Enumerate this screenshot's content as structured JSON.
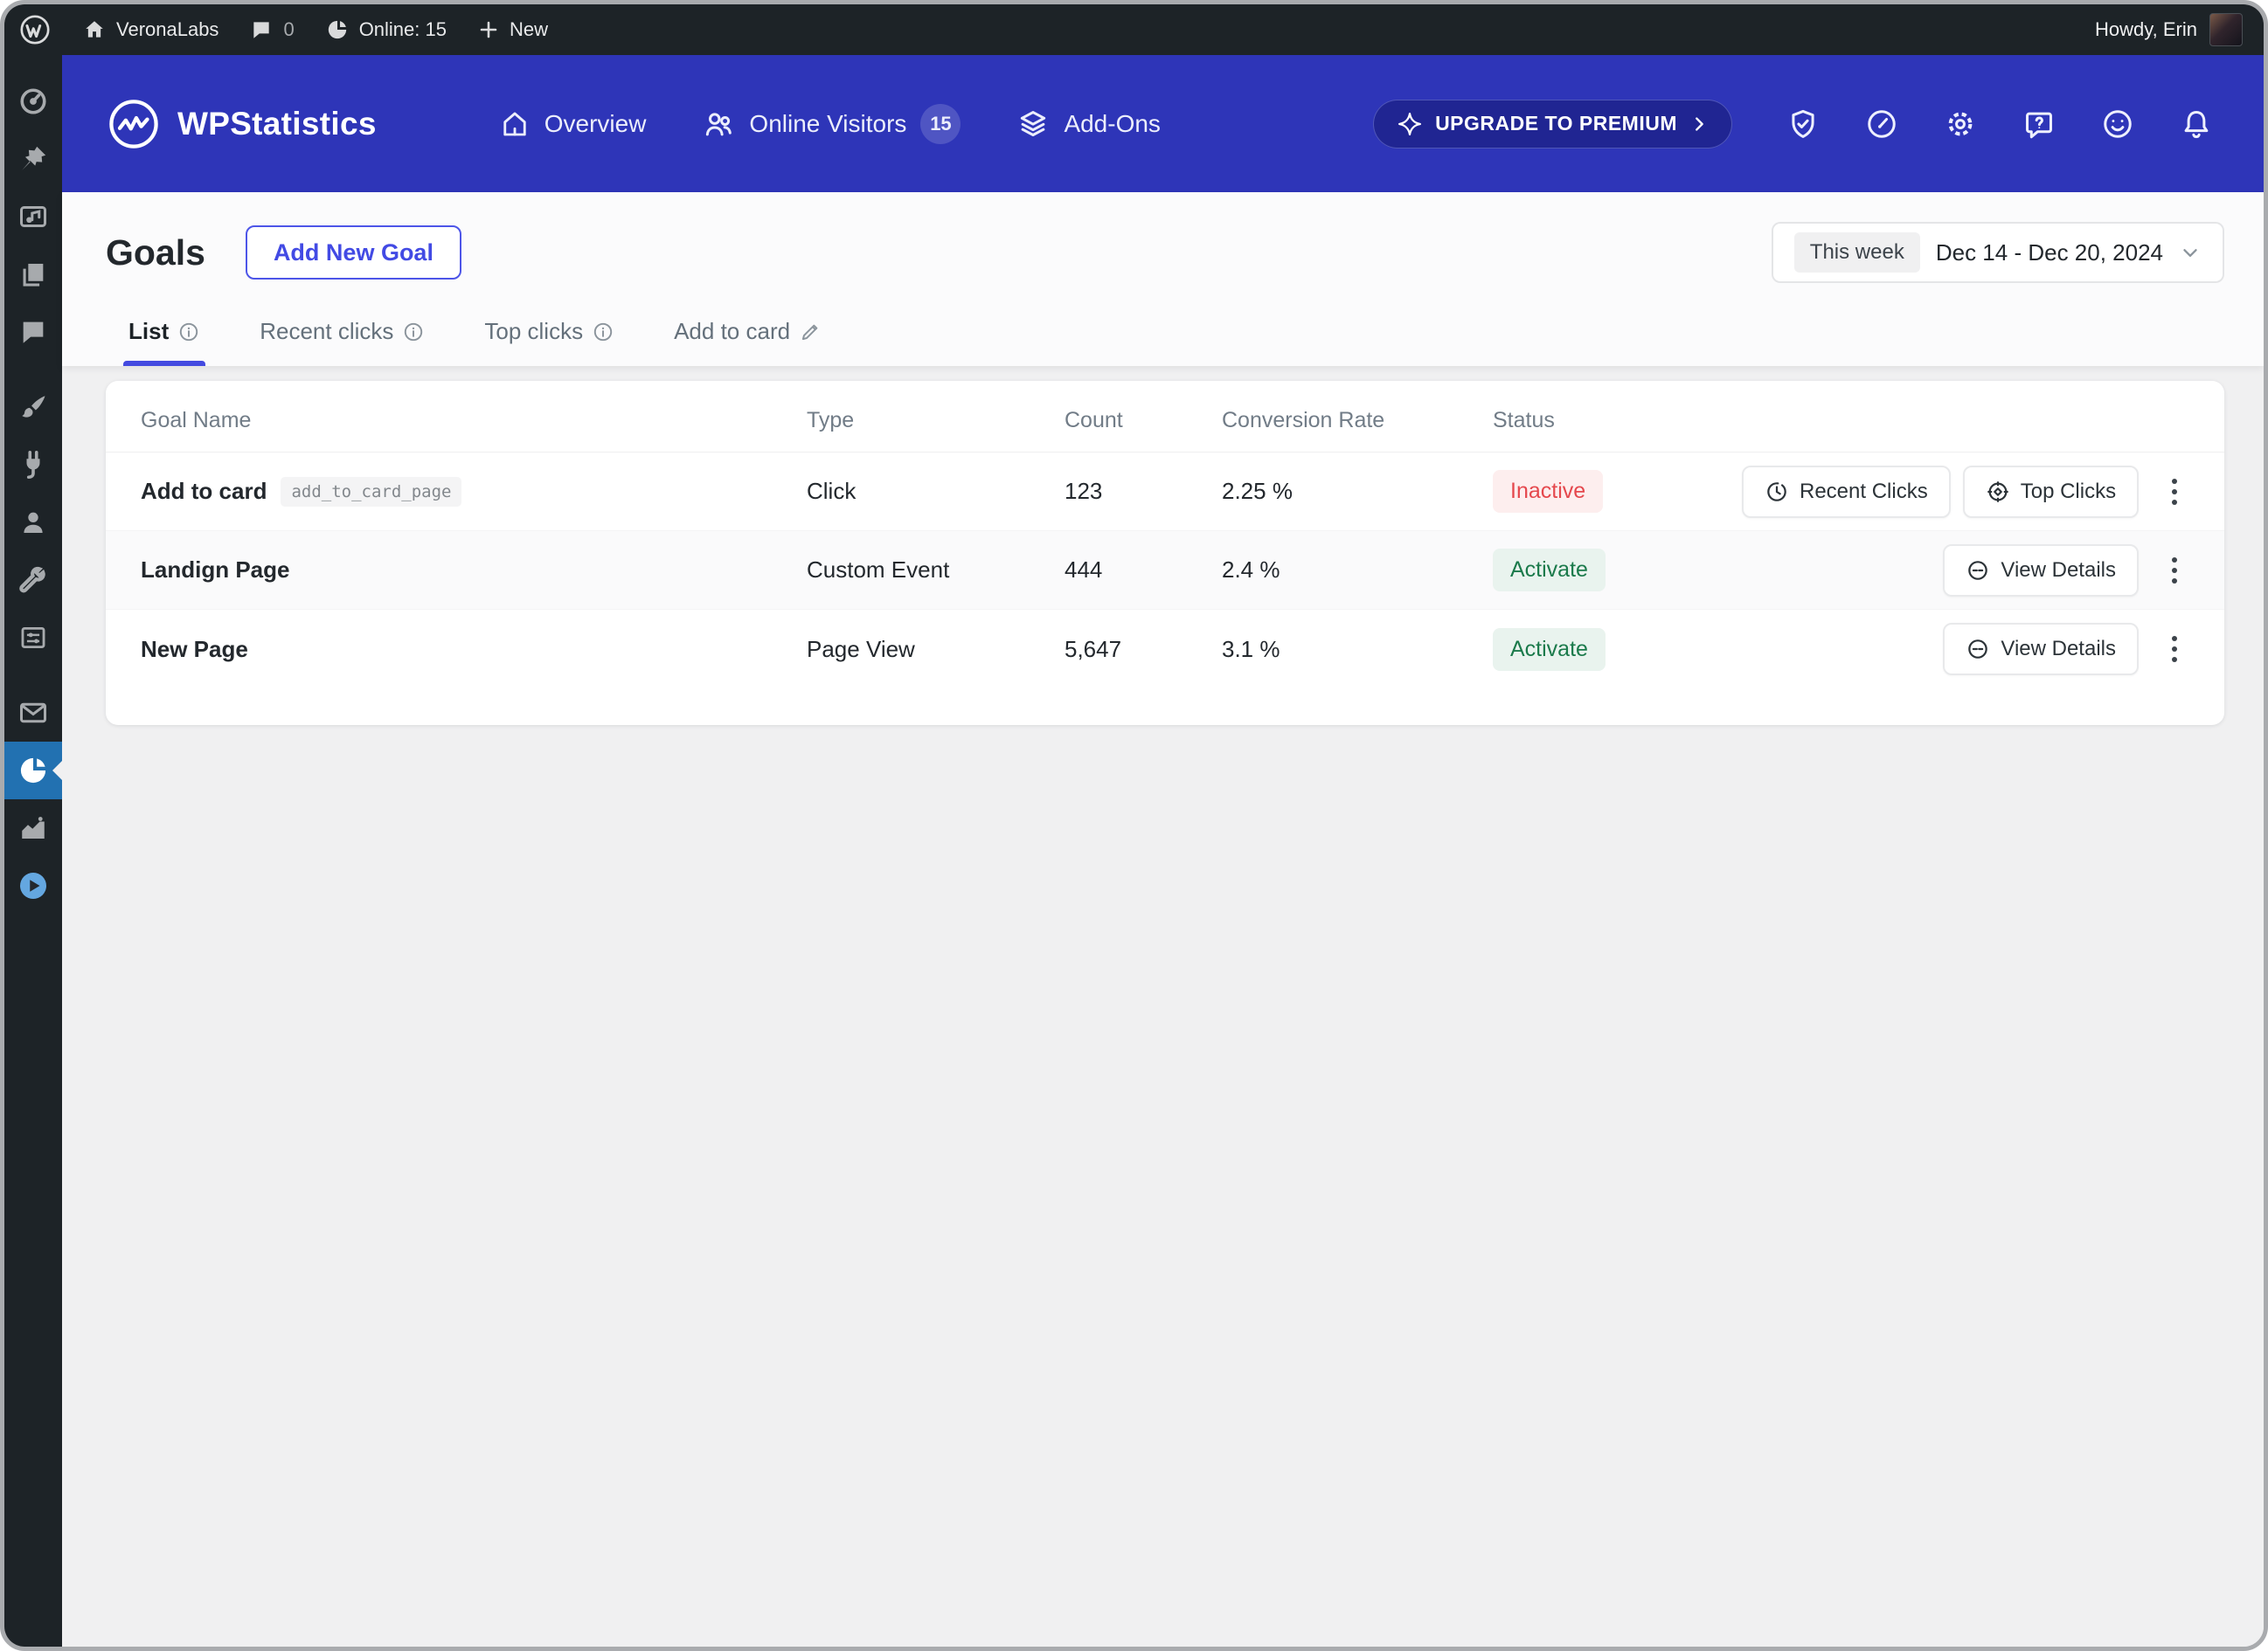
{
  "admin_bar": {
    "site_name": "VeronaLabs",
    "comments_count": "0",
    "online_label": "Online: 15",
    "new_label": "New",
    "howdy": "Howdy, Erin"
  },
  "plugin_header": {
    "brand": "WPStatistics",
    "nav": [
      {
        "label": "Overview"
      },
      {
        "label": "Online Visitors",
        "badge": "15"
      },
      {
        "label": "Add-Ons"
      }
    ],
    "upgrade_label": "UPGRADE TO PREMIUM"
  },
  "page": {
    "title": "Goals",
    "add_button_label": "Add New Goal",
    "date_filter": {
      "preset": "This week",
      "range": "Dec 14 - Dec 20, 2024"
    },
    "tabs": [
      {
        "label": "List",
        "active": true
      },
      {
        "label": "Recent clicks",
        "active": false
      },
      {
        "label": "Top clicks",
        "active": false
      },
      {
        "label": "Add to card",
        "active": false
      }
    ]
  },
  "table": {
    "columns": [
      "Goal Name",
      "Type",
      "Count",
      "Conversion Rate",
      "Status"
    ],
    "rows": [
      {
        "name": "Add to card",
        "slug": "add_to_card_page",
        "type": "Click",
        "count": "123",
        "conversion": "2.25 %",
        "status": "Inactive",
        "status_kind": "inactive",
        "actions": [
          {
            "label": "Recent Clicks",
            "icon": "clock-history-icon"
          },
          {
            "label": "Top Clicks",
            "icon": "crosshair-icon"
          }
        ]
      },
      {
        "name": "Landign Page",
        "slug": "",
        "type": "Custom Event",
        "count": "444",
        "conversion": "2.4 %",
        "status": "Activate",
        "status_kind": "active",
        "actions": [
          {
            "label": "View Details",
            "icon": "view-icon"
          }
        ]
      },
      {
        "name": "New Page",
        "slug": "",
        "type": "Page View",
        "count": "5,647",
        "conversion": "3.1 %",
        "status": "Activate",
        "status_kind": "active",
        "actions": [
          {
            "label": "View Details",
            "icon": "view-icon"
          }
        ]
      }
    ]
  },
  "sidebar": {
    "items": [
      {
        "icon": "dashboard-icon",
        "active": false
      },
      {
        "icon": "posts-pin-icon",
        "active": false
      },
      {
        "icon": "media-icon",
        "active": false
      },
      {
        "icon": "pages-icon",
        "active": false
      },
      {
        "icon": "comments-icon",
        "active": false
      },
      {
        "icon": "appearance-brush-icon",
        "active": false
      },
      {
        "icon": "plugins-icon",
        "active": false
      },
      {
        "icon": "users-icon",
        "active": false
      },
      {
        "icon": "tools-wrench-icon",
        "active": false
      },
      {
        "icon": "settings-sliders-icon",
        "active": false
      },
      {
        "icon": "mail-icon",
        "active": false
      },
      {
        "icon": "wp-statistics-pie-icon",
        "active": true
      },
      {
        "icon": "analytics-chart-icon",
        "active": false
      },
      {
        "icon": "video-play-icon",
        "active": false
      }
    ]
  },
  "colors": {
    "header_blue": "#2e35b8",
    "accent_blue": "#434ae0",
    "active_menu_blue": "#2271b1",
    "admin_dark": "#1d2327",
    "status_red": "#e5484d",
    "status_red_bg": "#fdeeee",
    "status_green": "#1b7a4b",
    "status_green_bg": "#e9f3ee",
    "content_bg": "#f0f0f1"
  }
}
